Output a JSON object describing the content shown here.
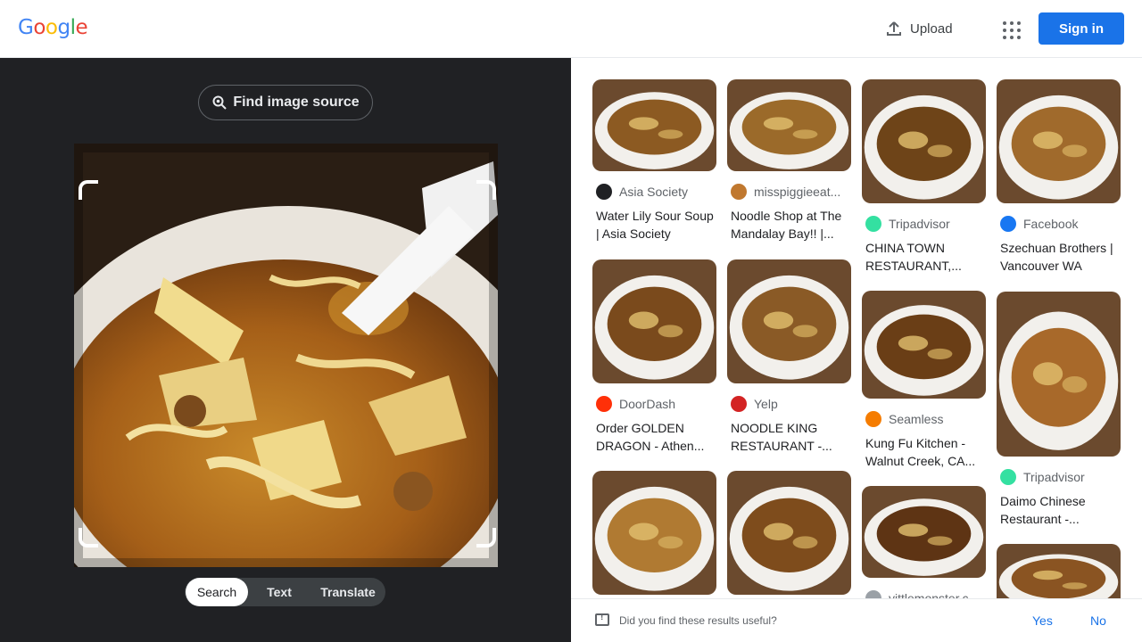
{
  "header": {
    "logo": [
      "G",
      "o",
      "o",
      "g",
      "l",
      "e"
    ],
    "logo_colors": [
      "#4285f4",
      "#ea4335",
      "#fbbc05",
      "#4285f4",
      "#34a853",
      "#ea4335"
    ],
    "upload_label": "Upload",
    "apps_icon": "apps-grid-icon",
    "sign_in_label": "Sign in"
  },
  "lens": {
    "find_source_label": "Find image source",
    "modes": [
      {
        "label": "Search",
        "active": true
      },
      {
        "label": "Text",
        "active": false
      },
      {
        "label": "Translate",
        "active": false
      }
    ]
  },
  "results": [
    {
      "source": "Asia Society",
      "favicon": "cat-icon",
      "favicon_color": "#202124",
      "title": "Water Lily Sour Soup | Asia Society"
    },
    {
      "source": "misspiggieeat...",
      "favicon": "piggie-icon",
      "favicon_color": "#c0782f",
      "title": "Noodle Shop at The Mandalay Bay!! |..."
    },
    {
      "source": "Tripadvisor",
      "favicon": "tripadvisor-icon",
      "favicon_color": "#34e0a1",
      "title": "CHINA TOWN RESTAURANT,..."
    },
    {
      "source": "Facebook",
      "favicon": "facebook-icon",
      "favicon_color": "#1877f2",
      "title": "Szechuan Brothers | Vancouver WA"
    },
    {
      "source": "DoorDash",
      "favicon": "doordash-icon",
      "favicon_color": "#ff3008",
      "title": "Order GOLDEN DRAGON - Athen..."
    },
    {
      "source": "Yelp",
      "favicon": "yelp-icon",
      "favicon_color": "#d32323",
      "title": "NOODLE KING RESTAURANT -..."
    },
    {
      "source": "Seamless",
      "favicon": "seamless-icon",
      "favicon_color": "#f57c00",
      "title": "Kung Fu Kitchen - Walnut Creek, CA..."
    },
    {
      "source": "Tripadvisor",
      "favicon": "tripadvisor-icon",
      "favicon_color": "#34e0a1",
      "title": "Daimo Chinese Restaurant -..."
    },
    {
      "source": "",
      "title": ""
    },
    {
      "source": "",
      "title": ""
    },
    {
      "source": "yittlemonster.c...",
      "favicon": "site-icon",
      "favicon_color": "#9aa0a6",
      "title": ""
    },
    {
      "source": "",
      "title": ""
    }
  ],
  "feedback": {
    "question": "Did you find these results useful?",
    "yes": "Yes",
    "no": "No"
  }
}
